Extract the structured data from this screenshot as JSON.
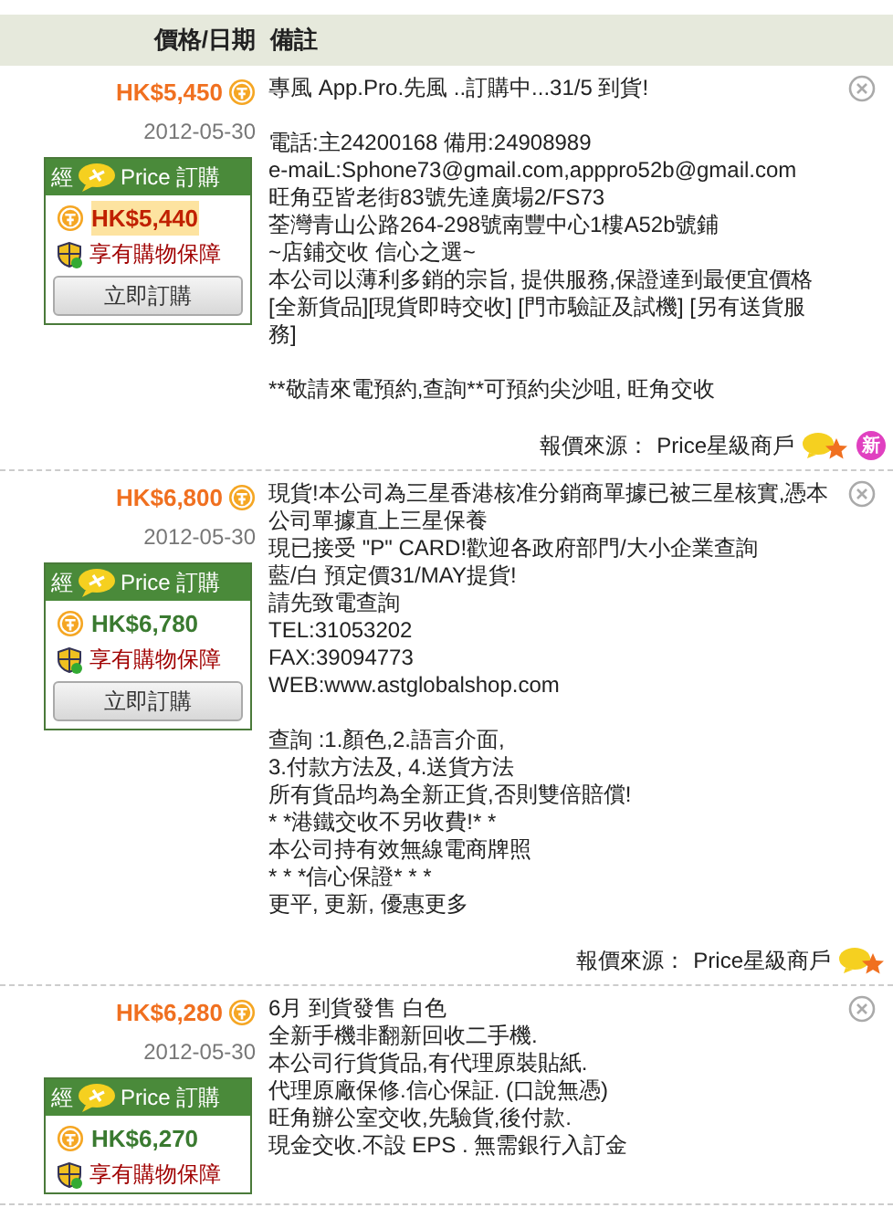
{
  "header": {
    "price_date": "價格/日期",
    "notes": "備註"
  },
  "offers": [
    {
      "price": "HK$5,450",
      "date": "2012-05-30",
      "box": {
        "brand_left": "經",
        "brand_right": "Price 訂購",
        "price": "HK$5,440",
        "highlighted": true,
        "guarantee": "享有購物保障",
        "button": "立即訂購"
      },
      "paragraphs": [
        [
          "專風 App.Pro.先風 ..訂購中...31/5 到貨!"
        ],
        [
          "電話:主24200168 備用:24908989",
          "e-maiL:Sphone73@gmail.com,apppro52b@gmail.com",
          "旺角亞皆老街83號先達廣場2/FS73",
          "荃灣青山公路264-298號南豐中心1樓A52b號鋪",
          "~店鋪交收 信心之選~",
          "本公司以薄利多銷的宗旨, 提供服務,保證達到最便宜價格",
          "[全新貨品][現貨即時交收] [門市驗証及試機] [另有送貨服務]"
        ],
        [
          "**敬請來電預約,查詢**可預約尖沙咀, 旺角交收"
        ]
      ],
      "source_label": "報價來源：",
      "source": "Price星級商戶",
      "is_new": true,
      "new_badge": "新"
    },
    {
      "price": "HK$6,800",
      "date": "2012-05-30",
      "box": {
        "brand_left": "經",
        "brand_right": "Price 訂購",
        "price": "HK$6,780",
        "highlighted": false,
        "guarantee": "享有購物保障",
        "button": "立即訂購"
      },
      "paragraphs": [
        [
          "現貨!本公司為三星香港核准分銷商單據已被三星核實,憑本公司單據直上三星保養",
          "現已接受 \"P\" CARD!歡迎各政府部門/大小企業查詢",
          "藍/白 預定價31/MAY提貨!",
          "請先致電查詢",
          "TEL:31053202",
          "FAX:39094773",
          "WEB:www.astglobalshop.com"
        ],
        [
          "查詢 :1.顏色,2.語言介面,",
          "3.付款方法及, 4.送貨方法",
          "所有貨品均為全新正貨,否則雙倍賠償!",
          "* *港鐵交收不另收費!* *",
          "本公司持有效無線電商牌照",
          "* * *信心保證* * *",
          "更平, 更新, 優惠更多"
        ]
      ],
      "source_label": "報價來源：",
      "source": "Price星級商戶",
      "is_new": false
    },
    {
      "price": "HK$6,280",
      "date": "2012-05-30",
      "box": {
        "brand_left": "經",
        "brand_right": "Price 訂購",
        "price": "HK$6,270",
        "highlighted": false,
        "guarantee": "享有購物保障"
      },
      "paragraphs": [
        [
          "6月 到貨發售 白色",
          "全新手機非翻新回收二手機.",
          "本公司行貨貨品,有代理原裝貼紙.",
          "代理原廠保修.信心保証. (口說無憑)",
          "旺角辦公室交收,先驗貨,後付款.",
          "現金交收.不設 EPS . 無需銀行入訂金"
        ]
      ],
      "is_new": false
    }
  ]
}
